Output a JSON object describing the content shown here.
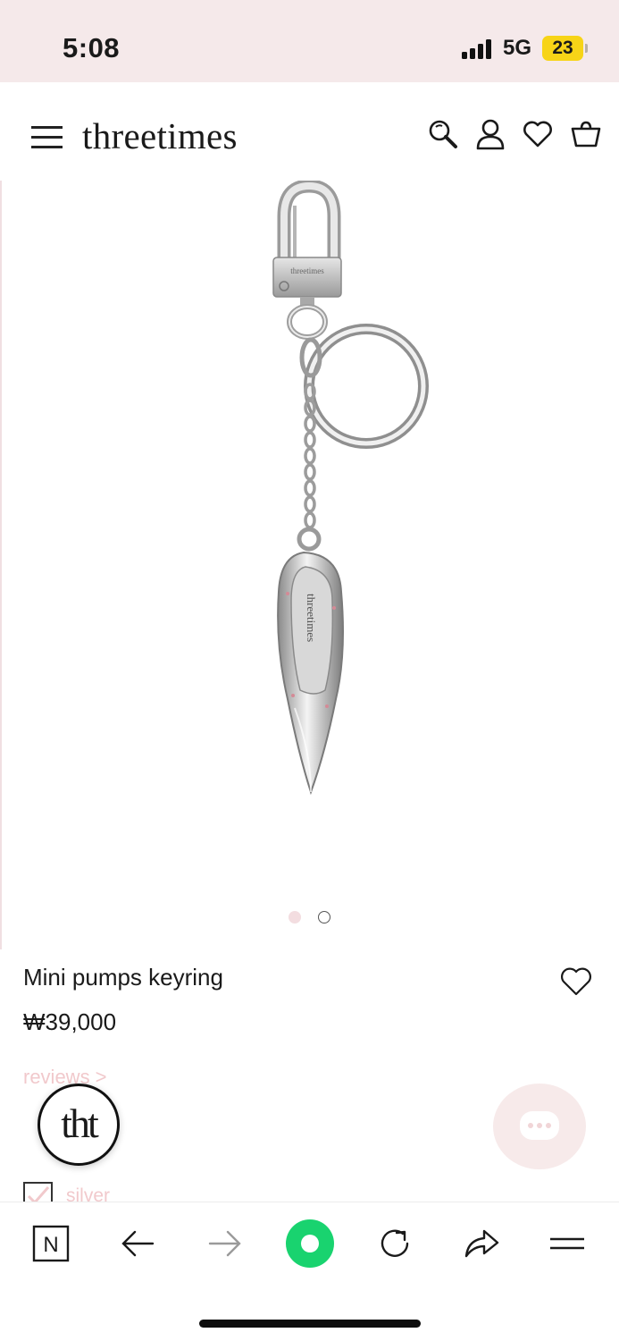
{
  "status_bar": {
    "time": "5:08",
    "network": "5G",
    "battery": "23"
  },
  "header": {
    "logo": "threetimes",
    "icons": [
      "menu-icon",
      "search-icon",
      "account-icon",
      "wishlist-icon",
      "cart-icon"
    ]
  },
  "gallery": {
    "image_subject": "silver pump-shaped keyring with clasp and ring",
    "slide_count": 2,
    "active_slide": 1
  },
  "product": {
    "name": "Mini pumps keyring",
    "price": "₩39,000",
    "reviews_link": "reviews >",
    "option_label": "silver"
  },
  "floating": {
    "badge_text": "tht"
  },
  "browser_toolbar": {
    "n_label": "N",
    "icons": [
      "naver-icon",
      "back-arrow-icon",
      "forward-arrow-icon",
      "home-icon",
      "refresh-icon",
      "share-icon",
      "menu-icon"
    ]
  },
  "colors": {
    "status_bg": "#f5e9ea",
    "accent_pink": "#f1c9cc",
    "green": "#19d36f",
    "battery_yellow": "#f7d417",
    "chat_bg": "#f7eaea"
  }
}
